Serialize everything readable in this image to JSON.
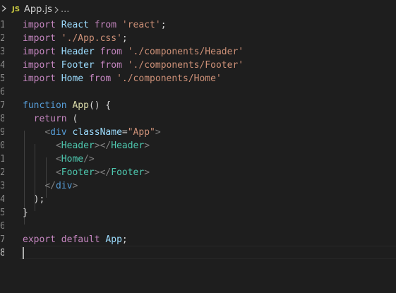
{
  "breadcrumb": {
    "file_badge": "JS",
    "file_name": "App.js",
    "ellipsis": "..."
  },
  "editor": {
    "language": "javascript",
    "line_numbers": [
      "1",
      "2",
      "3",
      "4",
      "5",
      "6",
      "7",
      "8",
      "9",
      "0",
      "1",
      "2",
      "3",
      "4",
      "5",
      "6",
      "7",
      "8"
    ],
    "active_line_number": "8",
    "lines": [
      [
        [
          "kw",
          "import"
        ],
        [
          "plain",
          " "
        ],
        [
          "var",
          "React"
        ],
        [
          "plain",
          " "
        ],
        [
          "kw",
          "from"
        ],
        [
          "plain",
          " "
        ],
        [
          "str",
          "'react'"
        ],
        [
          "plain",
          ";"
        ]
      ],
      [
        [
          "kw",
          "import"
        ],
        [
          "plain",
          " "
        ],
        [
          "str",
          "'./App.css'"
        ],
        [
          "plain",
          ";"
        ]
      ],
      [
        [
          "kw",
          "import"
        ],
        [
          "plain",
          " "
        ],
        [
          "var",
          "Header"
        ],
        [
          "plain",
          " "
        ],
        [
          "kw",
          "from"
        ],
        [
          "plain",
          " "
        ],
        [
          "str",
          "'./components/Header'"
        ]
      ],
      [
        [
          "kw",
          "import"
        ],
        [
          "plain",
          " "
        ],
        [
          "var",
          "Footer"
        ],
        [
          "plain",
          " "
        ],
        [
          "kw",
          "from"
        ],
        [
          "plain",
          " "
        ],
        [
          "str",
          "'./components/Footer'"
        ]
      ],
      [
        [
          "kw",
          "import"
        ],
        [
          "plain",
          " "
        ],
        [
          "var",
          "Home"
        ],
        [
          "plain",
          " "
        ],
        [
          "kw",
          "from"
        ],
        [
          "plain",
          " "
        ],
        [
          "str",
          "'./components/Home'"
        ]
      ],
      [],
      [
        [
          "kwb",
          "function"
        ],
        [
          "plain",
          " "
        ],
        [
          "fn",
          "App"
        ],
        [
          "plain",
          "() {"
        ]
      ],
      [
        [
          "plain",
          "  "
        ],
        [
          "kw",
          "return"
        ],
        [
          "plain",
          " ("
        ]
      ],
      [
        [
          "plain",
          "    "
        ],
        [
          "tagp",
          "<"
        ],
        [
          "kwb",
          "div"
        ],
        [
          "plain",
          " "
        ],
        [
          "attr",
          "className"
        ],
        [
          "plain",
          "="
        ],
        [
          "str",
          "\"App\""
        ],
        [
          "tagp",
          ">"
        ]
      ],
      [
        [
          "plain",
          "      "
        ],
        [
          "tagp",
          "<"
        ],
        [
          "tag",
          "Header"
        ],
        [
          "tagp",
          "></"
        ],
        [
          "tag",
          "Header"
        ],
        [
          "tagp",
          ">"
        ]
      ],
      [
        [
          "plain",
          "      "
        ],
        [
          "tagp",
          "<"
        ],
        [
          "tag",
          "Home"
        ],
        [
          "tagp",
          "/>"
        ]
      ],
      [
        [
          "plain",
          "      "
        ],
        [
          "tagp",
          "<"
        ],
        [
          "tag",
          "Footer"
        ],
        [
          "tagp",
          "></"
        ],
        [
          "tag",
          "Footer"
        ],
        [
          "tagp",
          ">"
        ]
      ],
      [
        [
          "plain",
          "    "
        ],
        [
          "tagp",
          "</"
        ],
        [
          "kwb",
          "div"
        ],
        [
          "tagp",
          ">"
        ]
      ],
      [
        [
          "plain",
          "  );"
        ]
      ],
      [
        [
          "plain",
          "}"
        ]
      ],
      [],
      [
        [
          "kw",
          "export"
        ],
        [
          "plain",
          " "
        ],
        [
          "kw",
          "default"
        ],
        [
          "plain",
          " "
        ],
        [
          "var",
          "App"
        ],
        [
          "plain",
          ";"
        ]
      ],
      []
    ]
  },
  "colors": {
    "background": "#1e1e1e",
    "keyword_control": "#c586c0",
    "keyword_storage": "#569cd6",
    "variable": "#9cdcfe",
    "string": "#ce9178",
    "function": "#dcdcaa",
    "component_tag": "#4ec9b0",
    "line_number": "#858585"
  }
}
